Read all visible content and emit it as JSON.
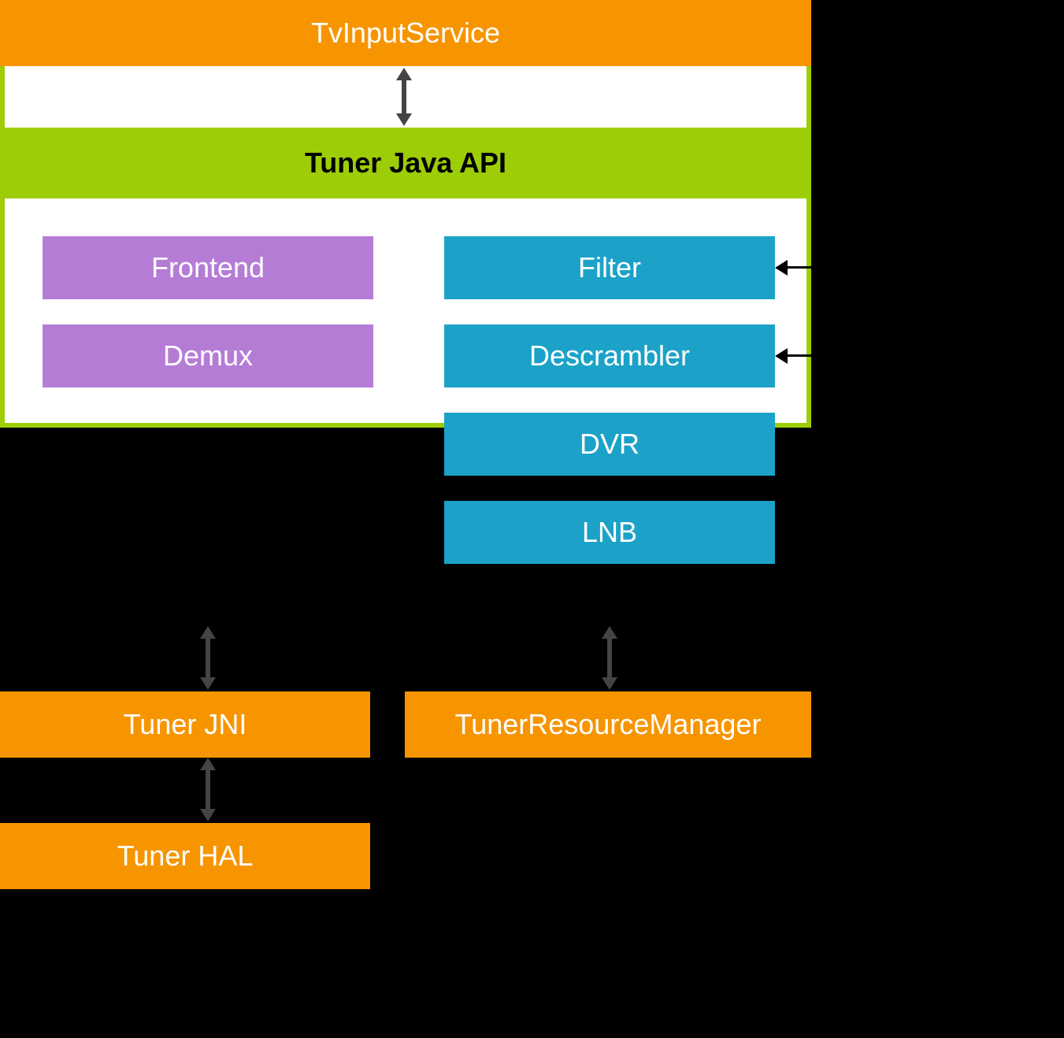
{
  "top": {
    "tvInputService": "TvInputService"
  },
  "tunerApi": {
    "header": "Tuner Java API",
    "left": {
      "frontend": "Frontend",
      "demux": "Demux"
    },
    "right": {
      "filter": "Filter",
      "descrambler": "Descrambler",
      "dvr": "DVR",
      "lnb": "LNB"
    }
  },
  "bottom": {
    "tunerJni": "Tuner JNI",
    "tunerResourceManager": "TunerResourceManager",
    "tunerHal": "Tuner HAL"
  },
  "colors": {
    "orange": "#f79500",
    "green": "#9dcd07",
    "purple": "#b57cd6",
    "blue": "#1ca2c8"
  }
}
